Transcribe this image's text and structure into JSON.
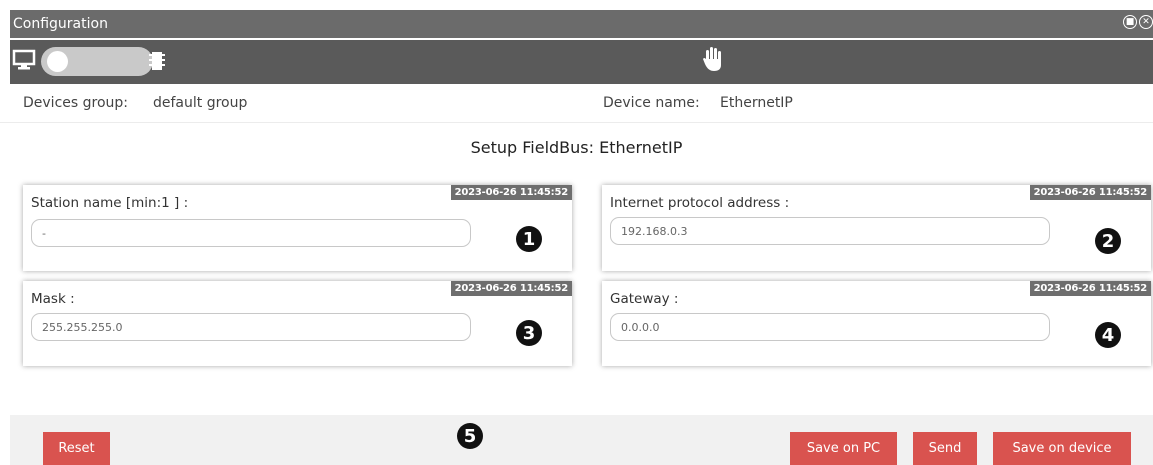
{
  "window": {
    "title": "Configuration"
  },
  "header": {
    "devices_group_label": "Devices group:",
    "devices_group_value": "default group",
    "device_name_label": "Device name:",
    "device_name_value": "EthernetIP"
  },
  "setup": {
    "title": "Setup FieldBus: EthernetIP"
  },
  "fields": {
    "station_name": {
      "label": "Station name [min:1 ] :",
      "timestamp": "2023-06-26 11:45:52",
      "value": "-",
      "marker": "1"
    },
    "ip_address": {
      "label": "Internet protocol address :",
      "timestamp": "2023-06-26 11:45:52",
      "value": "192.168.0.3",
      "marker": "2"
    },
    "mask": {
      "label": "Mask :",
      "timestamp": "2023-06-26 11:45:52",
      "value": "255.255.255.0",
      "marker": "3"
    },
    "gateway": {
      "label": "Gateway :",
      "timestamp": "2023-06-26 11:45:52",
      "value": "0.0.0.0",
      "marker": "4"
    }
  },
  "footer": {
    "marker": "5",
    "reset_label": "Reset",
    "save_pc_label": "Save on PC",
    "send_label": "Send",
    "save_device_label": "Save on device"
  },
  "icons": {
    "monitor": "monitor-icon",
    "chip": "chip-icon",
    "hand": "hand-icon",
    "pin": "pin-icon",
    "close": "close-icon"
  },
  "colors": {
    "title_bar": "#6b6b6b",
    "toolbar": "#5a5a5a",
    "button": "#d9534f",
    "timestamp_badge": "#6e6e6e"
  }
}
